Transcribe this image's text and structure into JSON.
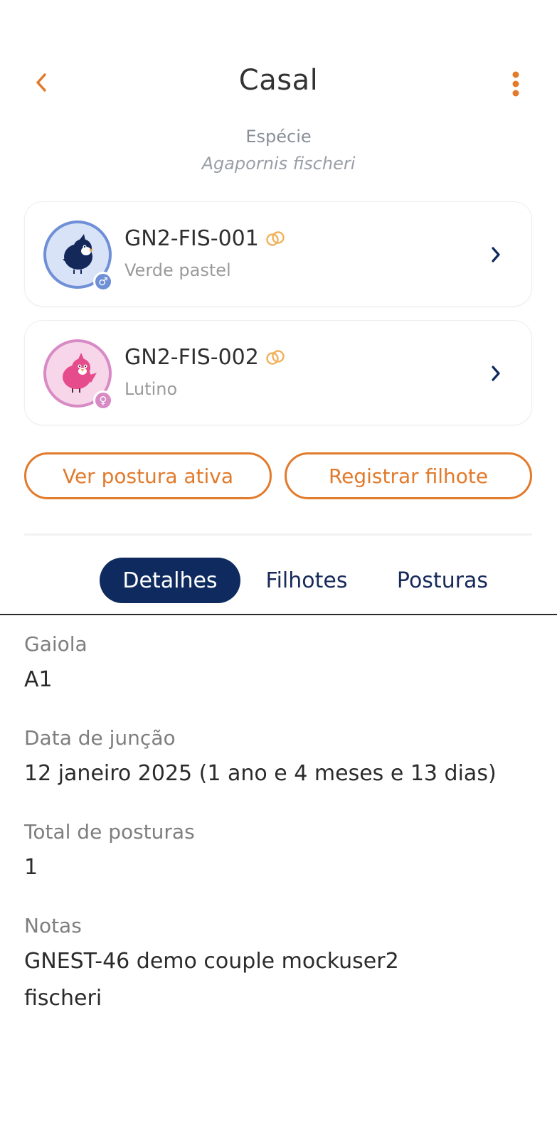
{
  "header": {
    "title": "Casal"
  },
  "species": {
    "label": "Espécie",
    "name": "Agapornis fischeri"
  },
  "birds": [
    {
      "ring": "GN2-FIS-001",
      "mutation": "Verde pastel",
      "sex": "male",
      "sex_symbol": "♂",
      "color": "#6f8fd6"
    },
    {
      "ring": "GN2-FIS-002",
      "mutation": "Lutino",
      "sex": "female",
      "sex_symbol": "♀",
      "color": "#d88ac4"
    }
  ],
  "actions": {
    "view_laying": "Ver postura ativa",
    "register_chick": "Registrar filhote"
  },
  "tabs": [
    {
      "label": "Detalhes",
      "active": true
    },
    {
      "label": "Filhotes",
      "active": false
    },
    {
      "label": "Posturas",
      "active": false
    }
  ],
  "details": {
    "cage_label": "Gaiola",
    "cage_value": "A1",
    "pairing_label": "Data de junção",
    "pairing_value": "12 janeiro 2025 (1 ano e 4 meses e 13 dias)",
    "total_label": "Total de posturas",
    "total_value": "1",
    "notes_label": "Notas",
    "notes_value_line1": "GNEST-46 demo couple mockuser2",
    "notes_value_line2": "fischeri"
  },
  "colors": {
    "accent": "#e27a2b",
    "navy": "#0e2a5e",
    "ring_icon": "#f0b15a"
  },
  "icons": {
    "back": "chevron-left-icon",
    "more": "kebab-menu-icon",
    "ring": "linked-rings-icon",
    "row_chevron": "chevron-right-icon"
  }
}
